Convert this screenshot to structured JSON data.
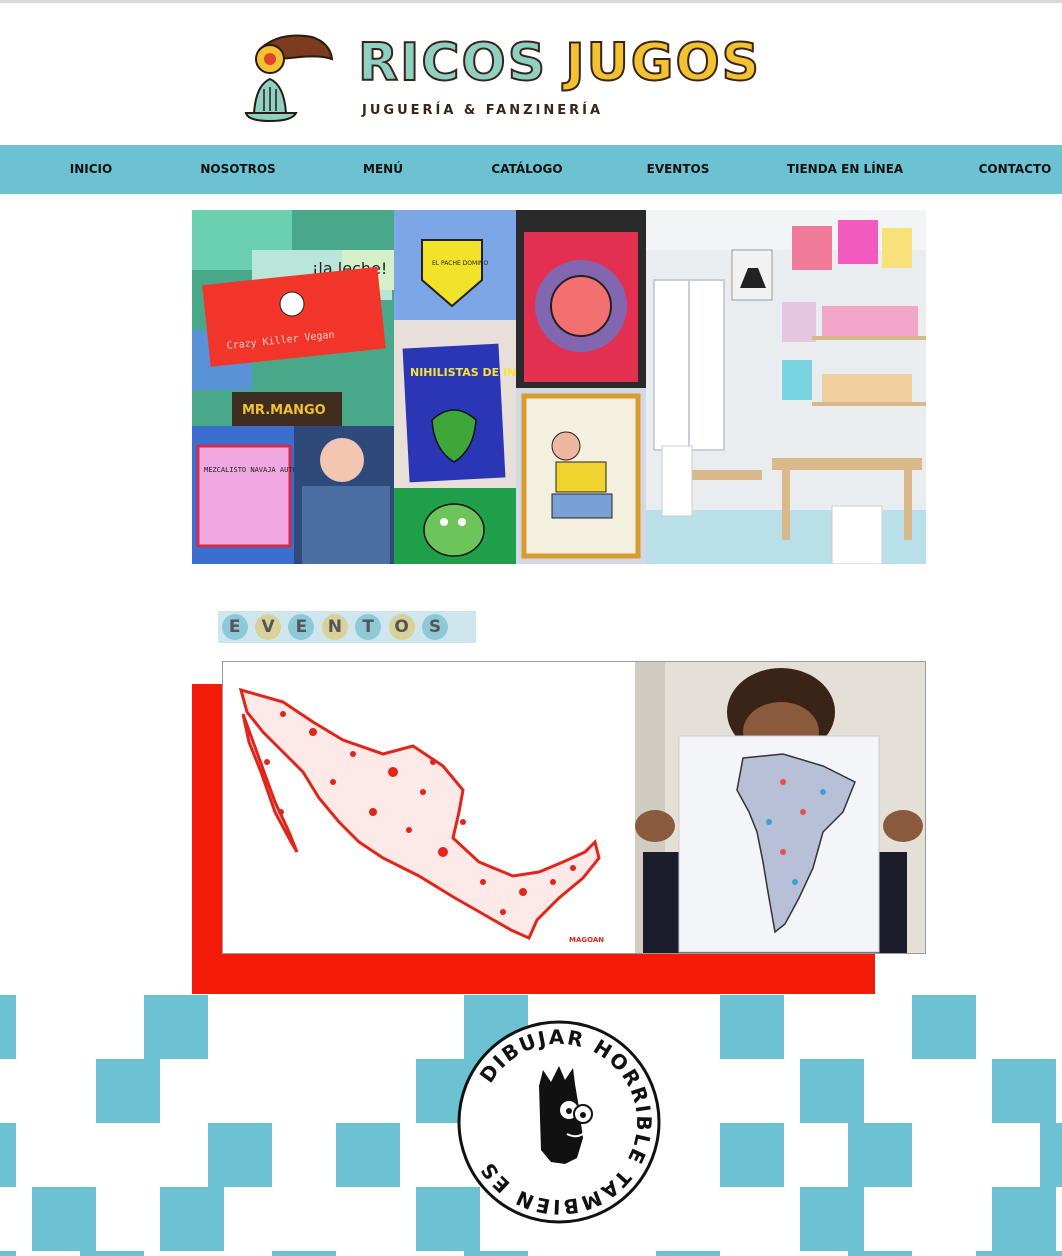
{
  "header": {
    "brand_name_1": "RICOS",
    "brand_name_2": "JUGOS",
    "tagline": "JUGUERÍA & FANZINERÍA",
    "logo_icon": "juicer-hand-icon"
  },
  "nav": {
    "items": [
      {
        "label": "INICIO"
      },
      {
        "label": "NOSOTROS"
      },
      {
        "label": "MENÚ"
      },
      {
        "label": "CATÁLOGO"
      },
      {
        "label": "EVENTOS"
      },
      {
        "label": "TIENDA EN LÍNEA"
      },
      {
        "label": "CONTACTO"
      }
    ]
  },
  "hero": {
    "zines": {
      "crazy": "Crazy Killer Vegan",
      "laleche": "¡la leche!",
      "mango": "MR.MANGO",
      "nihil": "NIHILISTAS DE INTERNET",
      "heart": "EL PACHE DOMINO",
      "mezcal": "MEZCALISTO NAVAJA AUTOMÁTICA"
    }
  },
  "eventos": {
    "letters": [
      "E",
      "V",
      "E",
      "N",
      "T",
      "O",
      "S"
    ],
    "colors": [
      "#8ec9d9",
      "#d8d29a",
      "#8ec9d9",
      "#d8d29a",
      "#8ec9d9",
      "#d8d29a",
      "#8ec9d9"
    ]
  },
  "event": {
    "signature": "MAGOAN"
  },
  "footer": {
    "stamp_text": "DIBUJAR HORRIBLE TAMBIEN ES",
    "pattern_color": "#6cc2d1"
  },
  "colors": {
    "nav": "#6cc2d1",
    "red": "#f41a08",
    "brand_mint": "#8fd0c4",
    "brand_yellow": "#f2c230"
  }
}
